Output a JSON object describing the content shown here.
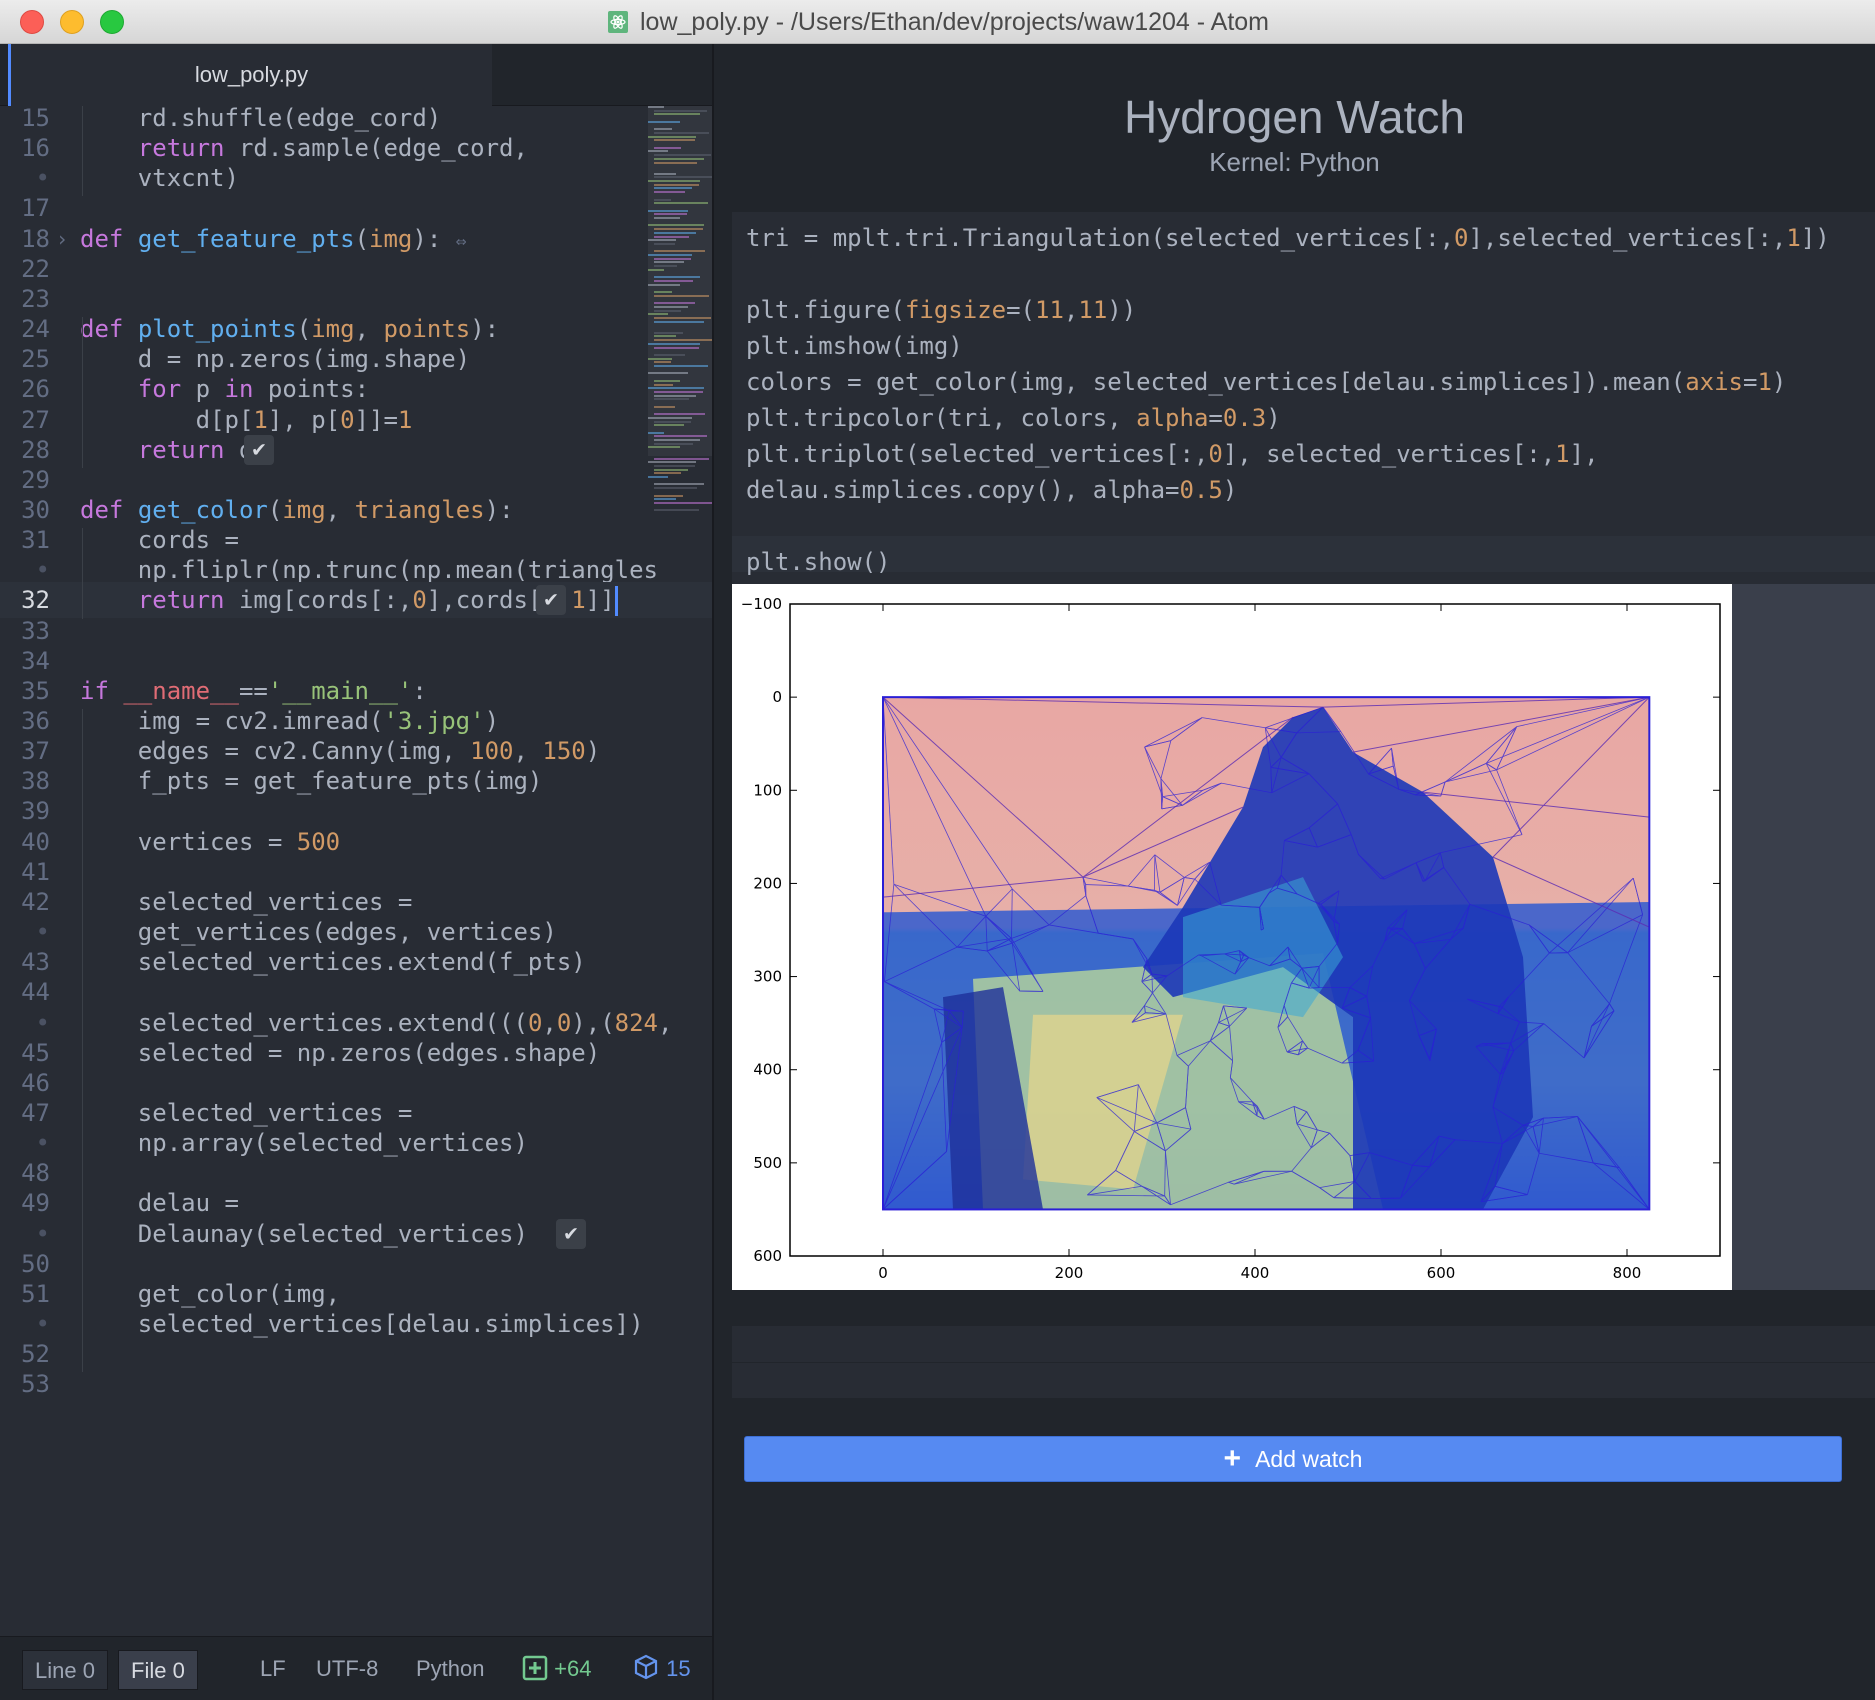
{
  "window": {
    "title": "low_poly.py - /Users/Ethan/dev/projects/waw1204 - Atom"
  },
  "tabs": [
    {
      "label": "low_poly.py",
      "active": true
    }
  ],
  "editor": {
    "language": "Python",
    "current_line": "32",
    "lines": [
      {
        "n": "15",
        "text": "    rd.shuffle(edge_cord)"
      },
      {
        "n": "16",
        "text": "    return rd.sample(edge_cord,"
      },
      {
        "n": "•",
        "text": "    vtxcnt)"
      },
      {
        "n": "17",
        "text": ""
      },
      {
        "n": "18",
        "text": "def get_feature_pts(img):"
      },
      {
        "n": "22",
        "text": ""
      },
      {
        "n": "23",
        "text": ""
      },
      {
        "n": "24",
        "text": "def plot_points(img, points):"
      },
      {
        "n": "25",
        "text": "    d = np.zeros(img.shape)"
      },
      {
        "n": "26",
        "text": "    for p in points:"
      },
      {
        "n": "27",
        "text": "        d[p[1], p[0]]=1"
      },
      {
        "n": "28",
        "text": "    return d"
      },
      {
        "n": "29",
        "text": ""
      },
      {
        "n": "30",
        "text": "def get_color(img, triangles):"
      },
      {
        "n": "31",
        "text": "    cords ="
      },
      {
        "n": "•",
        "text": "    np.fliplr(np.trunc(np.mean(triangles"
      },
      {
        "n": "32",
        "text": "    return img[cords[:,0],cords[:,1]]"
      },
      {
        "n": "33",
        "text": ""
      },
      {
        "n": "34",
        "text": ""
      },
      {
        "n": "35",
        "text": "if __name__=='__main__':"
      },
      {
        "n": "36",
        "text": "    img = cv2.imread('3.jpg')"
      },
      {
        "n": "37",
        "text": "    edges = cv2.Canny(img, 100, 150)"
      },
      {
        "n": "38",
        "text": "    f_pts = get_feature_pts(img)"
      },
      {
        "n": "39",
        "text": ""
      },
      {
        "n": "40",
        "text": "    vertices = 500"
      },
      {
        "n": "41",
        "text": ""
      },
      {
        "n": "42",
        "text": "    selected_vertices ="
      },
      {
        "n": "•",
        "text": "    get_vertices(edges, vertices)"
      },
      {
        "n": "43",
        "text": "    selected_vertices.extend(f_pts)"
      },
      {
        "n": "44",
        "text": ""
      },
      {
        "n": "•",
        "text": "    selected_vertices.extend(((0,0),(824,"
      },
      {
        "n": "45",
        "text": "    selected = np.zeros(edges.shape)"
      },
      {
        "n": "46",
        "text": ""
      },
      {
        "n": "47",
        "text": "    selected_vertices ="
      },
      {
        "n": "•",
        "text": "    np.array(selected_vertices)"
      },
      {
        "n": "48",
        "text": ""
      },
      {
        "n": "49",
        "text": "    delau ="
      },
      {
        "n": "•",
        "text": "    Delaunay(selected_vertices)"
      },
      {
        "n": "50",
        "text": ""
      },
      {
        "n": "51",
        "text": "    get_color(img,"
      },
      {
        "n": "•",
        "text": "    selected_vertices[delau.simplices])"
      },
      {
        "n": "52",
        "text": ""
      },
      {
        "n": "53",
        "text": ""
      }
    ]
  },
  "statusbar": {
    "line_label": "Line",
    "line_value": "0",
    "file_label": "File",
    "file_value": "0",
    "line_ending": "LF",
    "encoding": "UTF-8",
    "grammar": "Python",
    "git_added": "+64",
    "packages_count": "15"
  },
  "hydrogen": {
    "title": "Hydrogen Watch",
    "kernel": "Kernel: Python",
    "watch_code": [
      "tri = mplt.tri.Triangulation(selected_vertices[:,0],selected_vertices[:,1])",
      "",
      "plt.figure(figsize=(11,11))",
      "plt.imshow(img)",
      "colors = get_color(img, selected_vertices[delau.simplices]).mean(axis=1)",
      "plt.tripcolor(tri, colors, alpha=0.3)",
      "plt.triplot(selected_vertices[:,0], selected_vertices[:,1],",
      "delau.simplices.copy(), alpha=0.5)",
      "",
      "plt.show()"
    ],
    "add_watch_label": "Add watch"
  },
  "chart_data": {
    "type": "image-plot",
    "x_ticks": [
      "0",
      "200",
      "400",
      "600",
      "800"
    ],
    "y_ticks": [
      "−100",
      "0",
      "100",
      "200",
      "300",
      "400",
      "500",
      "600"
    ],
    "xlim": [
      -100,
      900
    ],
    "ylim": [
      600,
      -100
    ],
    "image_extent": {
      "x": [
        0,
        824
      ],
      "y": [
        0,
        550
      ]
    }
  },
  "colors": {
    "accent": "#568af2",
    "editor_bg": "#282c34",
    "pane_bg": "#21252b"
  }
}
